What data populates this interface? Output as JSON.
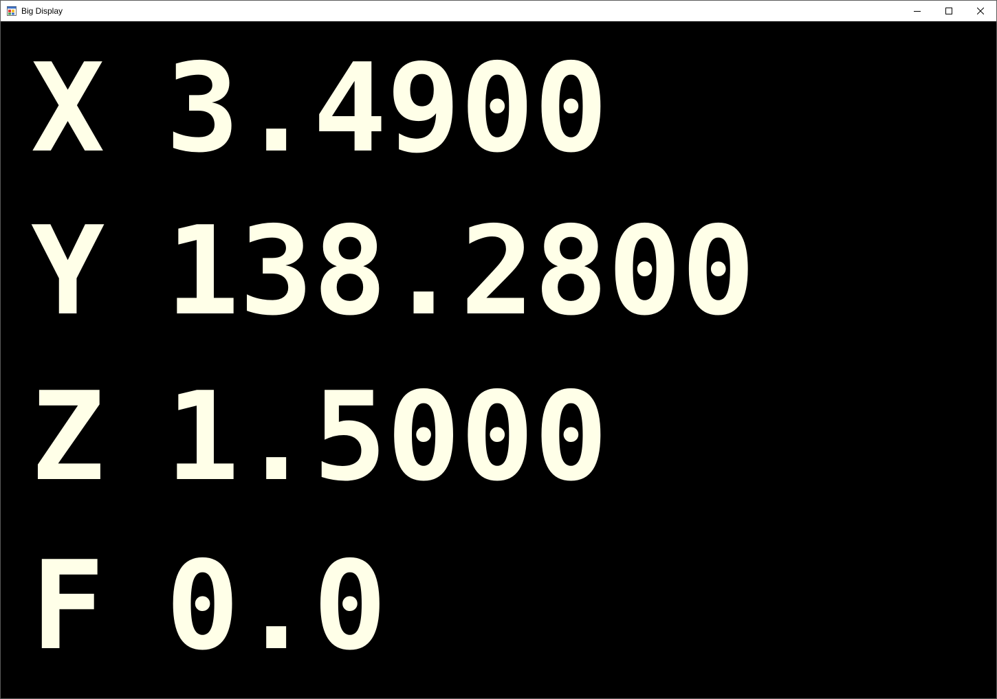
{
  "window": {
    "title": "Big Display",
    "icon": "app-window-icon",
    "controls": {
      "minimize_icon": "minimize-icon",
      "maximize_icon": "maximize-icon",
      "close_icon": "close-icon"
    }
  },
  "colors": {
    "background": "#000000",
    "text": "#ffffe8",
    "titlebar": "#ffffff"
  },
  "readouts": [
    {
      "label": "X",
      "value": "3.4900"
    },
    {
      "label": "Y",
      "value": "138.2800"
    },
    {
      "label": "Z",
      "value": "1.5000"
    },
    {
      "label": "F",
      "value": "0.0"
    }
  ]
}
